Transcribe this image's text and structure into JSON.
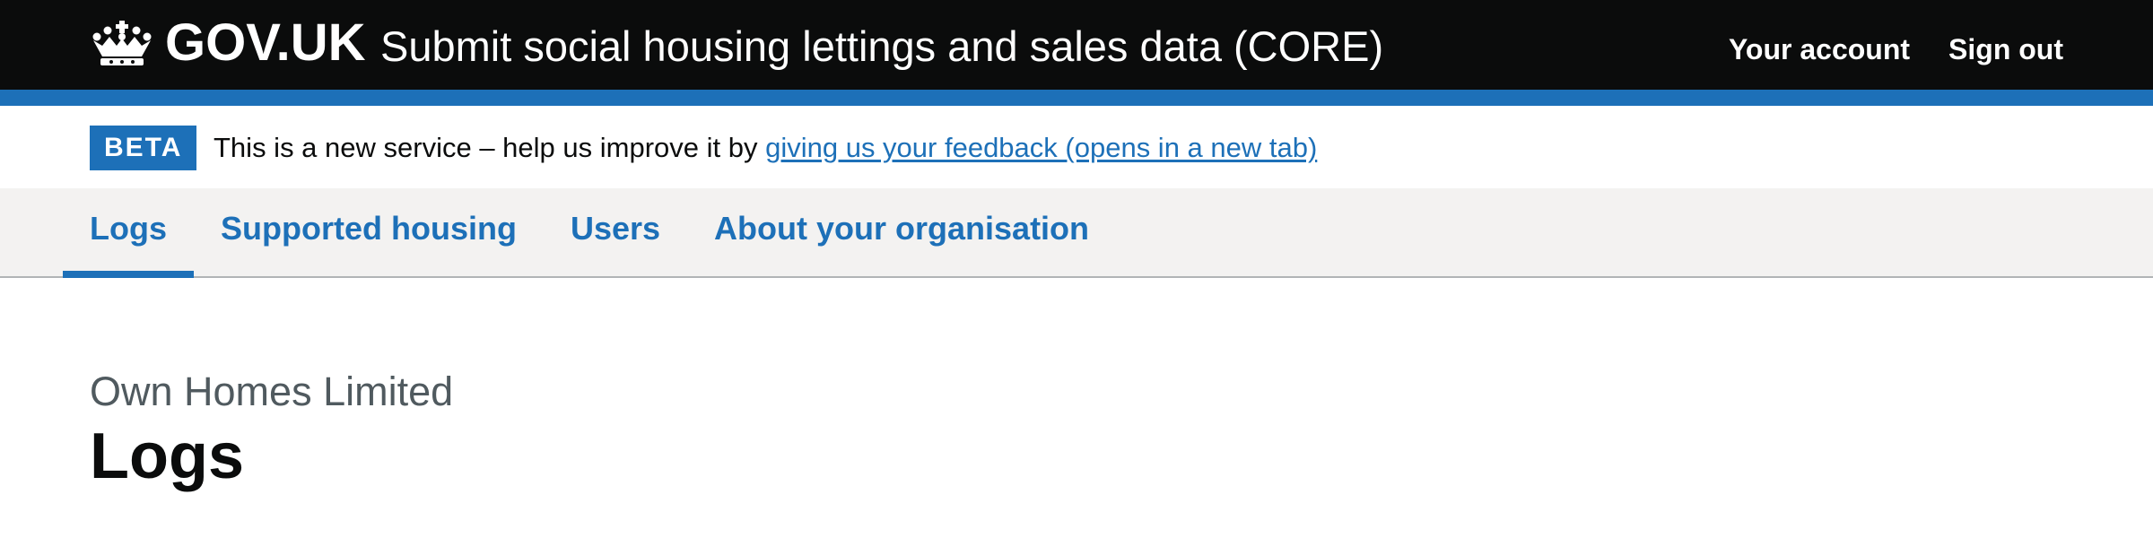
{
  "header": {
    "logotype": "GOV.UK",
    "service_name": "Submit social housing lettings and sales data (CORE)",
    "nav": {
      "account": "Your account",
      "sign_out": "Sign out"
    },
    "logo_icon": "crown-icon"
  },
  "phase_banner": {
    "tag": "BETA",
    "text": "This is a new service – help us improve it by ",
    "link": "giving us your feedback (opens in a new tab)"
  },
  "primary_nav": {
    "items": [
      {
        "label": "Logs",
        "current": true
      },
      {
        "label": "Supported housing",
        "current": false
      },
      {
        "label": "Users",
        "current": false
      },
      {
        "label": "About your organisation",
        "current": false
      }
    ]
  },
  "main": {
    "caption": "Own Homes Limited",
    "title": "Logs"
  },
  "colors": {
    "header_bg": "#0b0c0c",
    "brand_blue": "#1d70b8",
    "nav_bg": "#f3f2f1",
    "caption_grey": "#505a5f"
  }
}
